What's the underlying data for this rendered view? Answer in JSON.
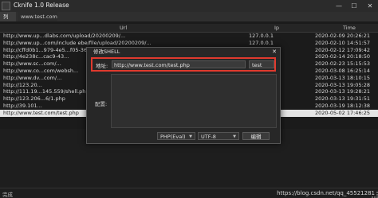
{
  "window": {
    "title": "Cknife 1.0 Release"
  },
  "tabs": [
    "列表",
    "www.test.com"
  ],
  "columns": {
    "url": "Url",
    "ip": "Ip",
    "time": "Time"
  },
  "rows": [
    {
      "url": "http://www.up...dlabs.com/upload/20200209/...",
      "ip": "127.0.0.1",
      "time": "2020-02-09 20:26:21",
      "selected": false
    },
    {
      "url": "http://www.up...com/include ebe/file/upload/20200209/...",
      "ip": "127.0.0.1",
      "time": "2020-02-10 14:51:57",
      "selected": false
    },
    {
      "url": "http://cffd0b1...979-4e5...f05-36...",
      "ip": "...",
      "time": "2020-02-12 17:09:42",
      "selected": false
    },
    {
      "url": "http://4e238c...cac9-43...",
      "ip": "...",
      "time": "2020-02-14 20:18:50",
      "selected": false
    },
    {
      "url": "http://www.sc...com/...",
      "ip": "...",
      "time": "2020-02-23 15:15:53",
      "selected": false
    },
    {
      "url": "http://www.co...com/websh...",
      "ip": "...",
      "time": "2020-03-08 16:25:14",
      "selected": false
    },
    {
      "url": "http://www.dv...com/...",
      "ip": "...",
      "time": "2020-03-13 18:10:15",
      "selected": false
    },
    {
      "url": "http://123.20...",
      "ip": "...",
      "time": "2020-03-13 19:05:28",
      "selected": false
    },
    {
      "url": "http://111.19...145.559/shell.php",
      "ip": "...",
      "time": "2020-03-13 19:28:21",
      "selected": false
    },
    {
      "url": "http://123.206...6/1.php",
      "ip": "...",
      "time": "2020-03-13 19:31:51",
      "selected": false
    },
    {
      "url": "http://39.101...",
      "ip": "...",
      "time": "2020-03-19 18:12:38",
      "selected": false
    },
    {
      "url": "http://www.test.com/test.php",
      "ip": "",
      "time": "2020-05-02 17:46:25",
      "selected": true
    }
  ],
  "dialog": {
    "title": "修改SHELL",
    "close": "✕",
    "address_label": "地址:",
    "address_value": "http://www.test.com/test.php",
    "password_value": "test",
    "config_label": "配置:",
    "config_value": "",
    "type_value": "PHP(Eval)",
    "encoding_value": "UTF-8",
    "edit_button": "编辑"
  },
  "status": {
    "text": "完成",
    "watermark": "https://blog.csdn.net/qq_45521281"
  },
  "icons": {
    "app": "app-icon",
    "minimize": "minimize-icon",
    "maximize": "maximize-icon",
    "close": "close-icon",
    "dropdown": "chevron-down-icon"
  },
  "colors": {
    "highlight_border": "#e03a2e",
    "selected_row": "#e4e4e4",
    "background": "#1b1b1b"
  }
}
